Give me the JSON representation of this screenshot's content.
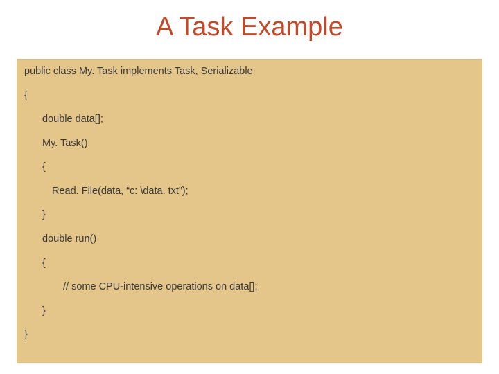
{
  "title": "A Task Example",
  "code": {
    "l1": "public class My. Task implements Task, Serializable",
    "l2": "{",
    "l3": "double data[];",
    "l4": "My. Task()",
    "l5": "{",
    "l6": "Read. File(data, “c: \\data. txt”);",
    "l7": "}",
    "l8": "double run()",
    "l9": "{",
    "l10": "// some CPU-intensive operations on data[];",
    "l11": "}",
    "l12": "}"
  }
}
